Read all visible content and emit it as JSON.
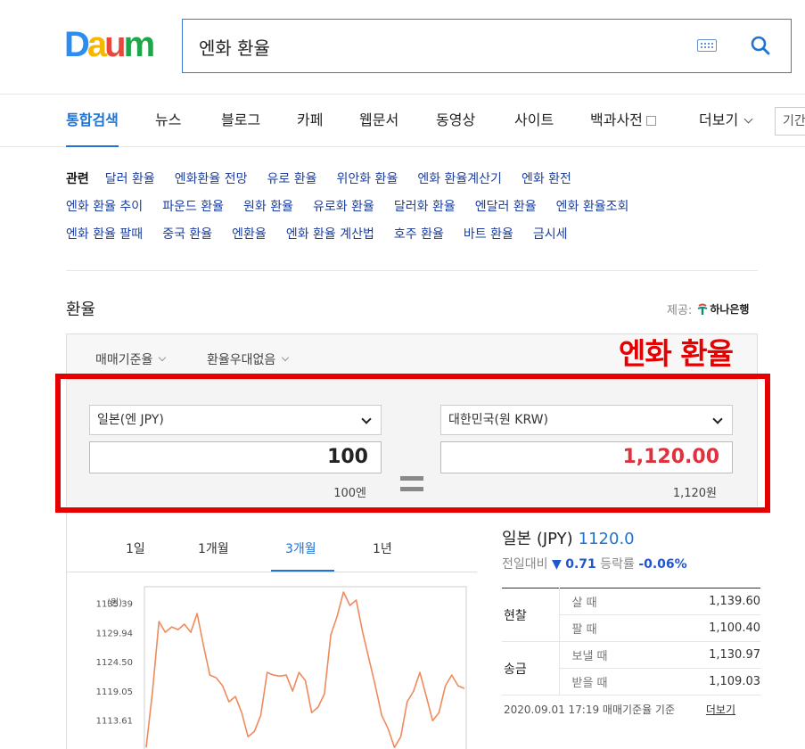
{
  "header": {
    "logo": {
      "letters": [
        "D",
        "a",
        "u",
        "m"
      ],
      "colors": [
        "#2d8cf0",
        "#f5b700",
        "#e8473c",
        "#1fa64b"
      ]
    },
    "search": {
      "query": "엔화 환율"
    }
  },
  "gnb": {
    "tabs": [
      "통합검색",
      "뉴스",
      "블로그",
      "카페",
      "웹문서",
      "동영상",
      "사이트",
      "백과사전"
    ],
    "active_tab": "통합검색",
    "more": "더보기",
    "box_text": "기간"
  },
  "related": {
    "heading": "관련",
    "rows": [
      [
        "달러 환율",
        "엔화환율 전망",
        "유로 환율",
        "위안화 환율",
        "엔화 환율계산기",
        "엔화 환전"
      ],
      [
        "엔화 환율 추이",
        "파운드 환율",
        "원화 환율",
        "유로화 환율",
        "달러화 환율",
        "엔달러 환율",
        "엔화 환율조회"
      ],
      [
        "엔화 환율 팔때",
        "중국 환율",
        "엔환율",
        "엔화 환율 계산법",
        "호주 환율",
        "바트 환율",
        "금시세"
      ]
    ]
  },
  "fx": {
    "title": "환율",
    "provider_label": "제공:",
    "provider_name": "하나은행",
    "option1": "매매기준율",
    "option2": "환율우대없음",
    "from_currency": "일본(엔 JPY)",
    "to_currency": "대한민국(원 KRW)",
    "from_amount": "100",
    "to_amount": "1,120.00",
    "from_sub": "100엔",
    "to_sub": "1,120원",
    "annotation": "엔화 환율"
  },
  "period_tabs": [
    "1일",
    "1개월",
    "3개월",
    "1년"
  ],
  "active_period": "3개월",
  "chart_data": {
    "type": "line",
    "ylabel": "(원)",
    "y_ticks": [
      "1135.39",
      "1129.94",
      "1124.50",
      "1119.05",
      "1113.61"
    ],
    "ylim": [
      1108.2,
      1139.0
    ],
    "series": [
      {
        "values": [
          1108.5,
          1119.0,
          1132.0,
          1130.0,
          1131.0,
          1130.5,
          1131.5,
          1130.0,
          1133.5,
          1127.5,
          1122.0,
          1121.5,
          1120.0,
          1117.0,
          1118.0,
          1115.0,
          1110.5,
          1111.5,
          1114.5,
          1122.5,
          1122.0,
          1121.8,
          1122.0,
          1119.0,
          1122.5,
          1121.0,
          1115.0,
          1116.0,
          1118.5,
          1129.5,
          1133.0,
          1137.5,
          1135.0,
          1136.0,
          1130.0,
          1125.0,
          1120.0,
          1114.5,
          1112.0,
          1108.5,
          1110.5,
          1117.0,
          1119.0,
          1122.5,
          1118.0,
          1113.5,
          1115.0,
          1120.0,
          1122.0,
          1120.0,
          1119.5
        ]
      }
    ]
  },
  "info": {
    "country": "일본 (JPY)",
    "rate": "1120.0",
    "prev_label": "전일대비",
    "change_arrow": "▼",
    "change": "0.71",
    "pct_label": "등락률",
    "pct": "-0.06%",
    "rows": [
      {
        "group": "현찰",
        "items": [
          {
            "kind": "살 때",
            "value": "1,139.60"
          },
          {
            "kind": "팔 때",
            "value": "1,100.40"
          }
        ]
      },
      {
        "group": "송금",
        "items": [
          {
            "kind": "보낼 때",
            "value": "1,130.97"
          },
          {
            "kind": "받을 때",
            "value": "1,109.03"
          }
        ]
      }
    ],
    "footer": "2020.09.01 17:19 매매기준율 기준",
    "more": "더보기"
  }
}
